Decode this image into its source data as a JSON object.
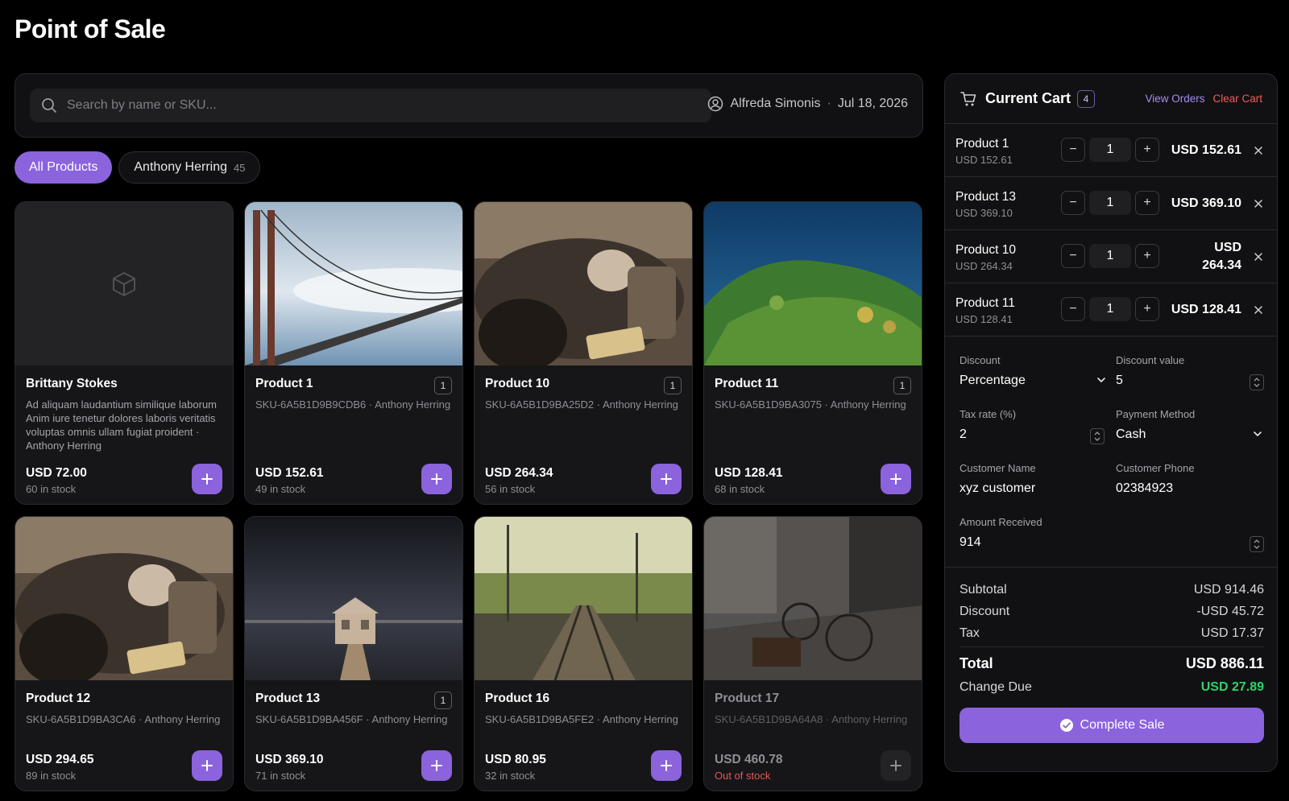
{
  "page_title": "Point of Sale",
  "search": {
    "placeholder": "Search by name or SKU..."
  },
  "user": {
    "name": "Alfreda Simonis",
    "separator": "·",
    "date": "Jul 18, 2026"
  },
  "filters": [
    {
      "label": "All Products",
      "active": true
    },
    {
      "label": "Anthony Herring",
      "count": "45",
      "active": false
    }
  ],
  "products": [
    {
      "name": "Brittany Stokes",
      "desc": "Ad aliquam laudantium similique laborum Anim iure tenetur dolores laboris veritatis voluptas omnis ullam fugiat proident · Anthony Herring",
      "price": "USD 72.00",
      "stock": "60 in stock",
      "image": "cube-placeholder-icon"
    },
    {
      "name": "Product 1",
      "meta": "SKU-6A5B1D9B9CDB6 · Anthony Herring",
      "badge": "1",
      "price": "USD 152.61",
      "stock": "49 in stock",
      "image": "bridge-fog-photo"
    },
    {
      "name": "Product 10",
      "meta": "SKU-6A5B1D9BA25D2 · Anthony Herring",
      "badge": "1",
      "price": "USD 264.34",
      "stock": "56 in stock",
      "image": "vintage-car-photo"
    },
    {
      "name": "Product 11",
      "meta": "SKU-6A5B1D9BA3075 · Anthony Herring",
      "badge": "1",
      "price": "USD 128.41",
      "stock": "68 in stock",
      "image": "aerial-forest-photo"
    },
    {
      "name": "Product 12",
      "meta": "SKU-6A5B1D9BA3CA6 · Anthony Herring",
      "price": "USD 294.65",
      "stock": "89 in stock",
      "image": "vintage-car-photo"
    },
    {
      "name": "Product 13",
      "meta": "SKU-6A5B1D9BA456F · Anthony Herring",
      "badge": "1",
      "price": "USD 369.10",
      "stock": "71 in stock",
      "image": "boathouse-night-photo"
    },
    {
      "name": "Product 16",
      "meta": "SKU-6A5B1D9BA5FE2 · Anthony Herring",
      "price": "USD 80.95",
      "stock": "32 in stock",
      "image": "railroad-track-photo"
    },
    {
      "name": "Product 17",
      "meta": "SKU-6A5B1D9BA64A8 · Anthony Herring",
      "price": "USD 460.78",
      "stock": "Out of stock",
      "image": "street-bicycles-photo",
      "out_of_stock": true
    }
  ],
  "cart": {
    "title": "Current Cart",
    "count": "4",
    "view_orders": "View Orders",
    "clear_cart": "Clear Cart",
    "items": [
      {
        "name": "Product 1",
        "unit": "USD 152.61",
        "qty": "1",
        "total": "USD 152.61"
      },
      {
        "name": "Product 13",
        "unit": "USD 369.10",
        "qty": "1",
        "total": "USD 369.10"
      },
      {
        "name": "Product 10",
        "unit": "USD 264.34",
        "qty": "1",
        "total": "USD 264.34"
      },
      {
        "name": "Product 11",
        "unit": "USD 128.41",
        "qty": "1",
        "total": "USD 128.41"
      }
    ],
    "form": {
      "discount_label": "Discount",
      "discount_type": "Percentage",
      "discount_value_label": "Discount value",
      "discount_value": "5",
      "tax_rate_label": "Tax rate (%)",
      "tax_rate": "2",
      "payment_method_label": "Payment Method",
      "payment_method": "Cash",
      "customer_name_label": "Customer Name",
      "customer_name": "xyz customer",
      "customer_phone_label": "Customer Phone",
      "customer_phone": "02384923",
      "amount_received_label": "Amount Received",
      "amount_received": "914"
    },
    "summary": {
      "subtotal_label": "Subtotal",
      "subtotal": "USD 914.46",
      "discount_label": "Discount",
      "discount": "-USD 45.72",
      "tax_label": "Tax",
      "tax": "USD 17.37",
      "total_label": "Total",
      "total": "USD 886.11",
      "change_label": "Change Due",
      "change": "USD 27.89"
    },
    "complete_label": "Complete Sale"
  },
  "colors": {
    "accent": "#8b63dd",
    "danger": "#ef5b5b",
    "success": "#2bd46a",
    "background": "#000000"
  }
}
